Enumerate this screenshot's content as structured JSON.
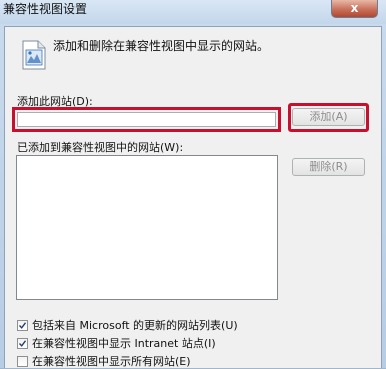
{
  "window": {
    "title": "兼容性视图设置",
    "close_glyph": "x"
  },
  "intro": {
    "icon": "document-image-icon",
    "text": "添加和删除在兼容性视图中显示的网站。"
  },
  "add_section": {
    "label": "添加此网站(D):",
    "input_value": "",
    "add_button_label": "添加(A)"
  },
  "list_section": {
    "label": "已添加到兼容性视图中的网站(W):",
    "sites": [],
    "delete_button_label": "删除(R)"
  },
  "options": [
    {
      "label": "包括来自 Microsoft 的更新的网站列表(U)",
      "checked": true
    },
    {
      "label": "在兼容性视图中显示 Intranet 站点(I)",
      "checked": true
    },
    {
      "label": "在兼容性视图中显示所有网站(E)",
      "checked": false
    }
  ],
  "colors": {
    "highlight": "#c8102e",
    "dialog_background": "#f0f0f0",
    "frame": "#c9dbee"
  }
}
